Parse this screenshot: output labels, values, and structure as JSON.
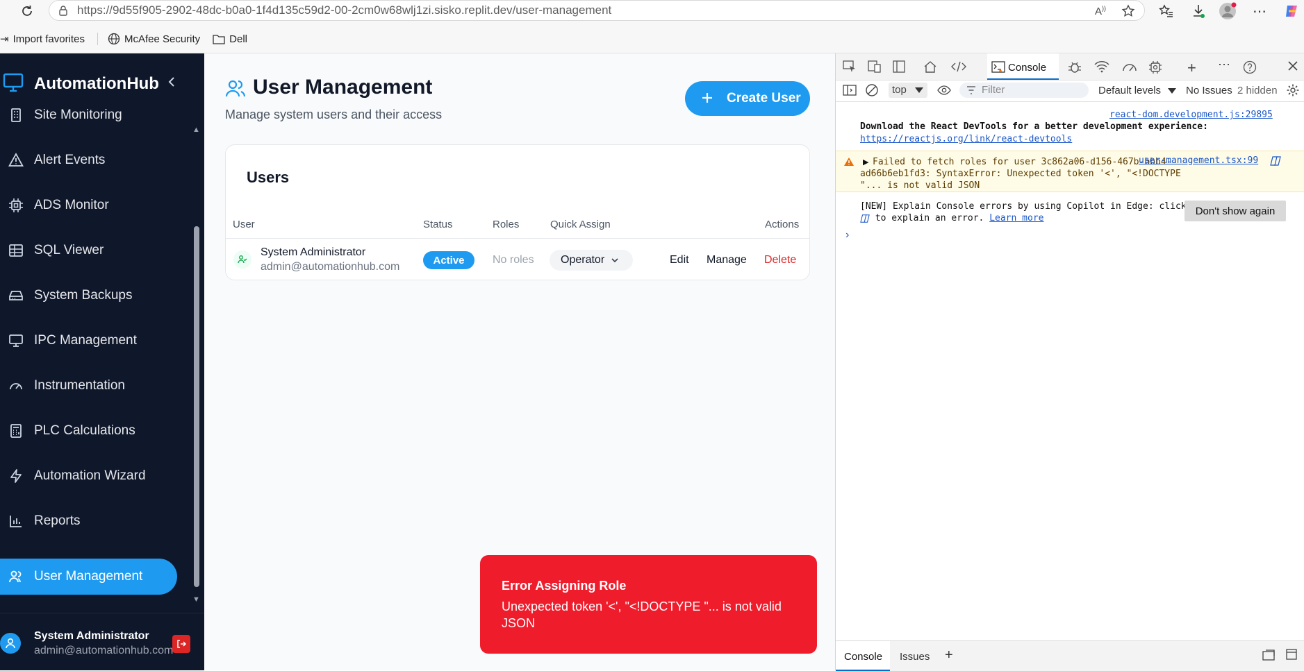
{
  "browser": {
    "url_domain": "https://9d55f905-2902-48dc-b0a0-1f4d135c59d2-00-2cm0w68wlj1zi.sisko.replit.dev",
    "url_path": "/user-management",
    "favorites": [
      {
        "label": "Import favorites",
        "icon": "import-icon"
      },
      {
        "label": "McAfee Security",
        "icon": "globe-icon"
      },
      {
        "label": "Dell",
        "icon": "folder-icon"
      }
    ]
  },
  "sidebar": {
    "brand": "AutomationHub",
    "items": [
      {
        "label": "Site Monitoring",
        "icon": "building-icon"
      },
      {
        "label": "Alert Events",
        "icon": "alert-triangle-icon"
      },
      {
        "label": "ADS Monitor",
        "icon": "cpu-icon"
      },
      {
        "label": "SQL Viewer",
        "icon": "table-icon"
      },
      {
        "label": "System Backups",
        "icon": "hard-drive-icon"
      },
      {
        "label": "IPC Management",
        "icon": "monitor-icon"
      },
      {
        "label": "Instrumentation",
        "icon": "gauge-icon"
      },
      {
        "label": "PLC Calculations",
        "icon": "calculator-icon"
      },
      {
        "label": "Automation Wizard",
        "icon": "zap-icon"
      },
      {
        "label": "Reports",
        "icon": "bar-chart-icon"
      },
      {
        "label": "User Management",
        "icon": "users-icon",
        "active": true
      }
    ],
    "user": {
      "name": "System Administrator",
      "email": "admin@automationhub.com"
    }
  },
  "main": {
    "title": "User Management",
    "subtitle": "Manage system users and their access",
    "create_button": "Create User",
    "users_card": {
      "title": "Users",
      "columns": [
        "User",
        "Status",
        "Roles",
        "Quick Assign",
        "Actions"
      ],
      "rows": [
        {
          "name": "System Administrator",
          "email": "admin@automationhub.com",
          "status": "Active",
          "roles": "No roles",
          "quick_assign": "Operator",
          "actions": [
            "Edit",
            "Manage",
            "Delete"
          ]
        }
      ]
    },
    "toast": {
      "title": "Error Assigning Role",
      "message": "Unexpected token '<', \"<!DOCTYPE \"... is not valid JSON"
    }
  },
  "devtools": {
    "active_tab": "Console",
    "context": "top",
    "filter_placeholder": "Filter",
    "levels": "Default levels",
    "issues": "No Issues",
    "hidden": "2 hidden",
    "logs": {
      "react_source": "react-dom.development.js:29895",
      "react_message": "Download the React DevTools for a better development experience:",
      "react_link": "https://reactjs.org/link/react-devtools",
      "warn_message": "Failed to fetch roles for user 3c862a06-d156-467b-bbb4-ad66b6eb1fd3: SyntaxError: Unexpected token '<', \"<!DOCTYPE \"... is not valid JSON",
      "warn_source": "user-management.tsx:99",
      "copilot_prefix": "[NEW] Explain Console errors by using Copilot in Edge: click",
      "copilot_suffix": "to explain an error.",
      "copilot_link": "Learn more",
      "dont_show": "Don't show again"
    },
    "drawer": {
      "console": "Console",
      "issues": "Issues"
    }
  }
}
